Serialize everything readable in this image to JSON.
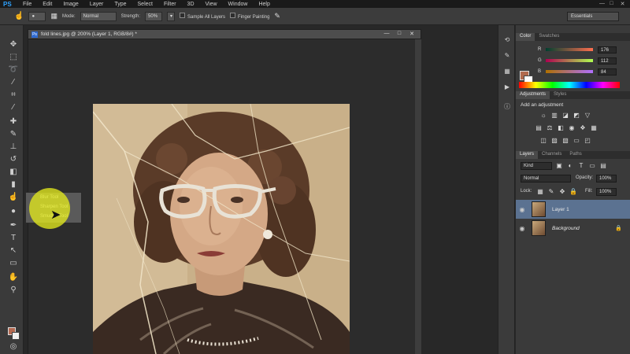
{
  "app": {
    "logo": "PS",
    "menu": [
      "File",
      "Edit",
      "Image",
      "Layer",
      "Type",
      "Select",
      "Filter",
      "3D",
      "View",
      "Window",
      "Help"
    ],
    "window_controls": [
      "—",
      "□",
      "✕"
    ]
  },
  "options_bar": {
    "mode_label": "Mode:",
    "mode_value": "Normal",
    "strength_label": "Strength:",
    "strength_value": "50%",
    "sample_all_layers": "Sample All Layers",
    "finger_painting": "Finger Painting",
    "workspace": "Essentials"
  },
  "flyout": {
    "items": [
      "Blur Tool",
      "Sharpen Tool",
      "Smudge Tool"
    ]
  },
  "document": {
    "title": "fold lines.jpg @ 200% (Layer 1, RGB/8#) *",
    "icon_text": "Ps"
  },
  "color_panel": {
    "tabs": [
      "Color",
      "Swatches"
    ],
    "channels": [
      {
        "letter": "R",
        "value": "176",
        "gradient": "linear-gradient(90deg,#003f2f,#ff6f4f)"
      },
      {
        "letter": "G",
        "value": "112",
        "gradient": "linear-gradient(90deg,#b00050,#b0ff50)"
      },
      {
        "letter": "B",
        "value": "84",
        "gradient": "linear-gradient(90deg,#b07000,#b070ff)"
      }
    ],
    "foreground": "#b06a4e",
    "background": "#ffffff"
  },
  "adjustments_panel": {
    "tabs": [
      "Adjustments",
      "Styles"
    ],
    "header": "Add an adjustment"
  },
  "layers_panel": {
    "tabs": [
      "Layers",
      "Channels",
      "Paths"
    ],
    "kind": "Kind",
    "blend_mode": "Normal",
    "opacity_label": "Opacity:",
    "opacity_value": "100%",
    "lock_label": "Lock:",
    "fill_label": "Fill:",
    "fill_value": "100%",
    "layers": [
      {
        "name": "Layer 1",
        "selected": true
      },
      {
        "name": "Background",
        "selected": false
      }
    ]
  }
}
